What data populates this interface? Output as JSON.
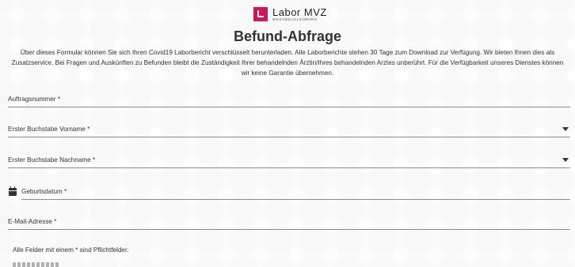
{
  "header": {
    "logo_name": "Labor MVZ",
    "logo_sub": "WESTMECKLENBURG",
    "title": "Befund-Abfrage",
    "intro": "Über dieses Formular können Sie sich Ihren Covid19 Laborbericht verschlüsselt herunterladen. Alle Laborberichte stehen 30 Tage zum Download zur Verfügung. Wir bieten Ihnen dies als Zusatzservice. Bei Fragen und Auskünften zu Befunden bleibt die Zuständigkeit Ihrer behandelnden Ärztin/Ihres behandelnden Arztes unberührt. Für die Verfügbarkeit unseres Dienstes können wir keine Garantie übernehmen."
  },
  "form": {
    "order_number_label": "Auftragsnummer *",
    "first_name_initial_label": "Erster Buchstabe Vorname *",
    "last_name_initial_label": "Erster Buchstabe Nachname *",
    "birthdate_label": "Geburtsdatum *",
    "email_label": "E-Mail-Adresse *",
    "required_note": "Alle Felder mit einem * sind Pflichtfelder."
  },
  "colors": {
    "brand": "#d4145a",
    "text": "#333333",
    "underline": "#8a8a8a"
  }
}
